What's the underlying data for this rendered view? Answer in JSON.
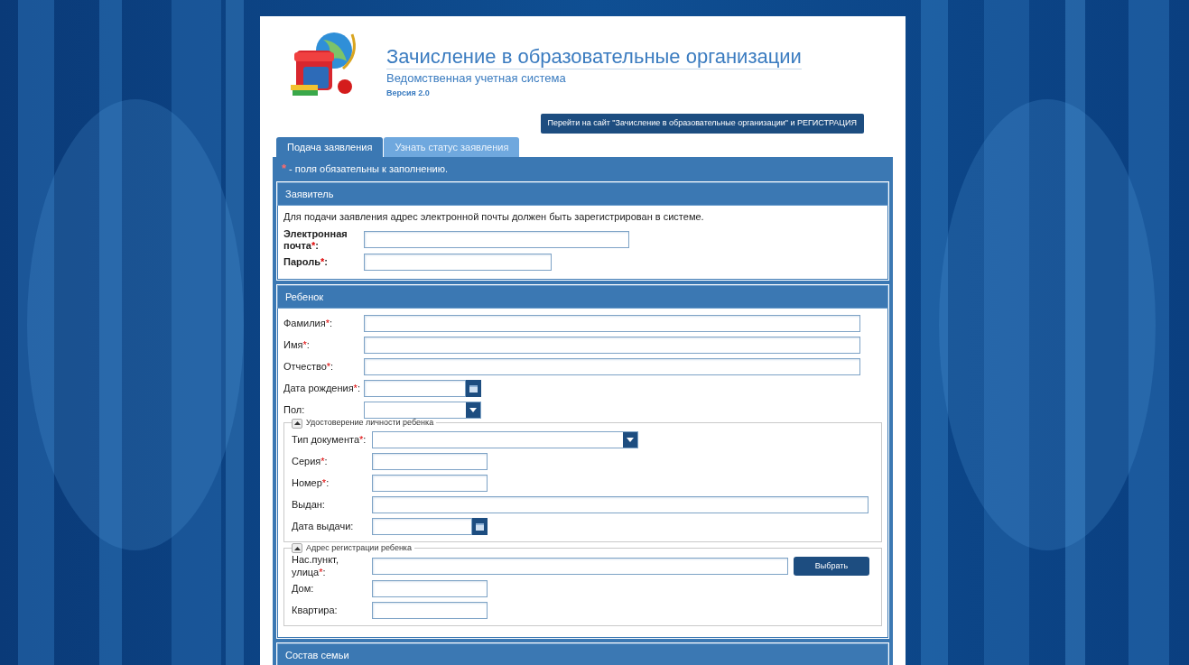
{
  "header": {
    "title": "Зачисление в образовательные организации",
    "subtitle": "Ведомственная учетная система",
    "version": "Версия 2.0"
  },
  "link_button": {
    "label": "Перейти на сайт \"Зачисление в образовательные организации\" и РЕГИСТРАЦИЯ"
  },
  "tabs": [
    {
      "label": "Подача заявления",
      "selected": true
    },
    {
      "label": "Узнать статус заявления",
      "selected": false
    }
  ],
  "required_note": {
    "mark": "*",
    "text": "- поля обязательны к заполнению."
  },
  "sections": [
    {
      "title": "Заявитель",
      "note": "Для подачи заявления адрес электронной почты должен быть зарегистрирован в системе.",
      "bold_labels": true,
      "fields": [
        {
          "label": "Электронная почта",
          "required": "*",
          "colon": ":",
          "kind": "text"
        },
        {
          "label": "Пароль",
          "required": "*",
          "colon": ":",
          "kind": "text"
        }
      ]
    },
    {
      "title": "Ребенок",
      "bold_labels": false,
      "fields": [
        {
          "label": "Фамилия",
          "required": "*",
          "colon": ":",
          "kind": "text"
        },
        {
          "label": "Имя",
          "required": "*",
          "colon": ":",
          "kind": "text"
        },
        {
          "label": "Отчество",
          "required": "*",
          "colon": ":",
          "kind": "text"
        },
        {
          "label": "Дата рождения",
          "required": "*",
          "colon": ":",
          "kind": "date"
        },
        {
          "label": "Пол",
          "colon": ":",
          "kind": "select"
        }
      ],
      "groups": [
        {
          "title": "Удостоверение личности ребенка",
          "expanded": true,
          "fields": [
            {
              "label": "Тип документа",
              "required": "*",
              "colon": ":",
              "kind": "select"
            },
            {
              "label": "Серия",
              "required": "*",
              "colon": ":",
              "kind": "text"
            },
            {
              "label": "Номер",
              "required": "*",
              "colon": ":",
              "kind": "text"
            },
            {
              "label": "Выдан",
              "colon": ":",
              "kind": "text"
            },
            {
              "label": "Дата выдачи",
              "colon": ":",
              "kind": "date"
            }
          ]
        },
        {
          "title": "Адрес регистрации ребенка",
          "expanded": true,
          "fields": [
            {
              "label": "Нас.пункт, улица",
              "required": "*",
              "colon": ":",
              "kind": "picker",
              "button": "Выбрать"
            },
            {
              "label": "Дом",
              "colon": ":",
              "kind": "text"
            },
            {
              "label": "Квартира",
              "colon": ":",
              "kind": "text"
            }
          ]
        }
      ]
    },
    {
      "title": "Состав семьи"
    }
  ]
}
